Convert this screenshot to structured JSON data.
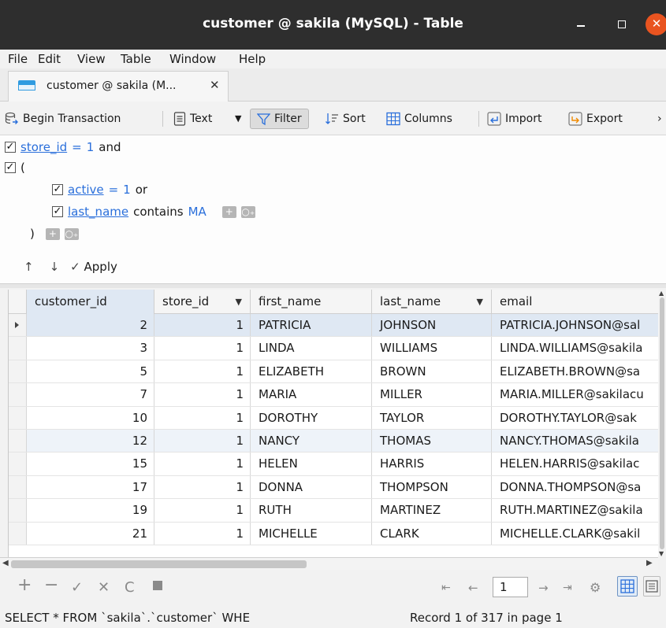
{
  "window": {
    "title": "customer @ sakila (MySQL) - Table",
    "close_glyph": "✕"
  },
  "menu": [
    "File",
    "Edit",
    "View",
    "Table",
    "Window",
    "Help"
  ],
  "tab": {
    "label": "customer @ sakila (M...",
    "close": "✕"
  },
  "toolbar": {
    "begin_transaction": "Begin Transaction",
    "text": "Text",
    "filter": "Filter",
    "sort": "Sort",
    "columns": "Columns",
    "import": "Import",
    "export": "Export",
    "more": "›"
  },
  "filter": {
    "row1": {
      "field": "store_id",
      "op": "=",
      "value": "1",
      "conj": "and"
    },
    "group_open": "(",
    "row2": {
      "field": "active",
      "op": "=",
      "value": "1",
      "conj": "or"
    },
    "row3": {
      "field": "last_name",
      "op": "contains",
      "value": "MA"
    },
    "group_close": ")",
    "apply": "Apply"
  },
  "grid": {
    "columns": [
      "customer_id",
      "store_id",
      "first_name",
      "last_name",
      "email"
    ],
    "rows": [
      [
        "2",
        "1",
        "PATRICIA",
        "JOHNSON",
        "PATRICIA.JOHNSON@sal"
      ],
      [
        "3",
        "1",
        "LINDA",
        "WILLIAMS",
        "LINDA.WILLIAMS@sakila"
      ],
      [
        "5",
        "1",
        "ELIZABETH",
        "BROWN",
        "ELIZABETH.BROWN@sa"
      ],
      [
        "7",
        "1",
        "MARIA",
        "MILLER",
        "MARIA.MILLER@sakilacu"
      ],
      [
        "10",
        "1",
        "DOROTHY",
        "TAYLOR",
        "DOROTHY.TAYLOR@sak"
      ],
      [
        "12",
        "1",
        "NANCY",
        "THOMAS",
        "NANCY.THOMAS@sakila"
      ],
      [
        "15",
        "1",
        "HELEN",
        "HARRIS",
        "HELEN.HARRIS@sakilac"
      ],
      [
        "17",
        "1",
        "DONNA",
        "THOMPSON",
        "DONNA.THOMPSON@sa"
      ],
      [
        "19",
        "1",
        "RUTH",
        "MARTINEZ",
        "RUTH.MARTINEZ@sakila"
      ],
      [
        "21",
        "1",
        "MICHELLE",
        "CLARK",
        "MICHELLE.CLARK@sakil"
      ]
    ]
  },
  "pager": {
    "page": "1"
  },
  "status": {
    "sql": "SELECT * FROM `sakila`.`customer` WHE",
    "record": "Record 1 of 317 in page 1"
  },
  "colors": {
    "titlebar": "#2e2e2e",
    "close": "#e95420",
    "accent": "#2a6fdb",
    "selected_row": "#dfe8f3"
  }
}
